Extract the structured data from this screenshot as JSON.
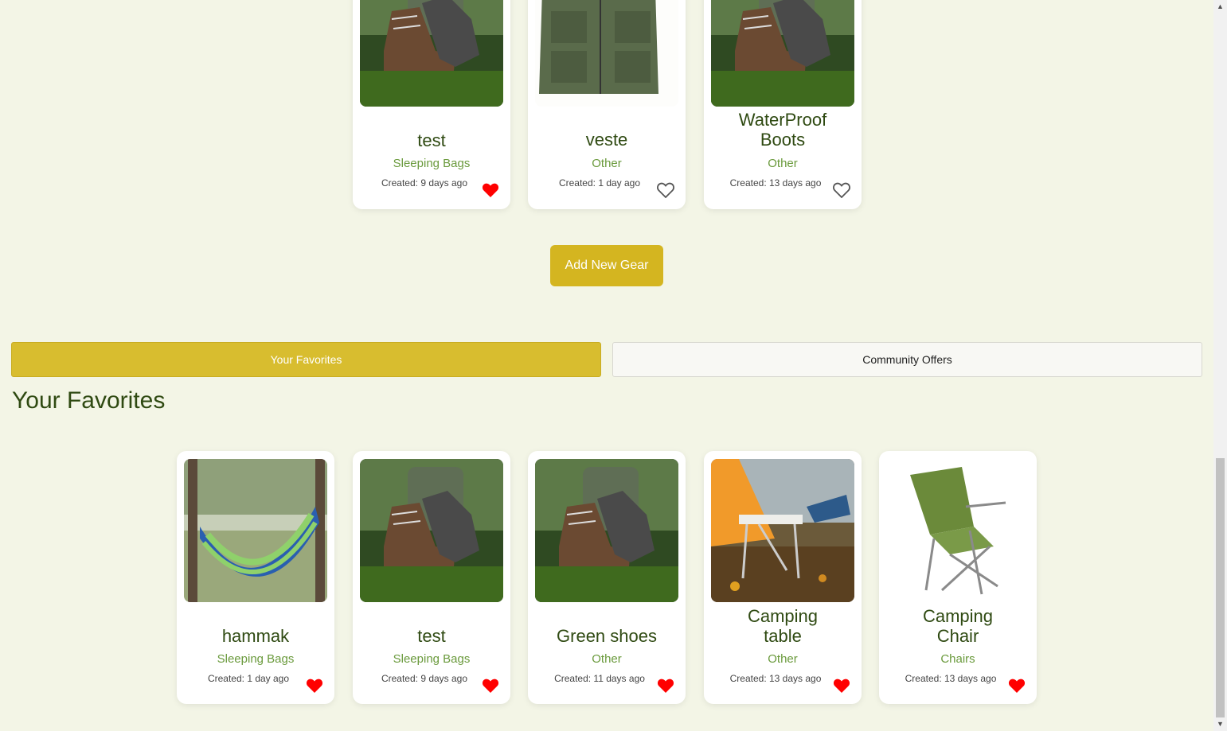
{
  "gear_list": {
    "items": [
      {
        "title": "test",
        "category": "Sleeping Bags",
        "created": "Created: 9 days ago",
        "favorite": true,
        "image": "boots-photo"
      },
      {
        "title": "veste",
        "category": "Other",
        "created": "Created: 1 day ago",
        "favorite": false,
        "image": "vest-photo"
      },
      {
        "title": "WaterProof Boots",
        "category": "Other",
        "created": "Created: 13 days ago",
        "favorite": false,
        "image": "boots-photo"
      }
    ],
    "add_button_label": "Add New Gear"
  },
  "tabs": {
    "favorites_label": "Your Favorites",
    "community_label": "Community Offers",
    "active": "favorites"
  },
  "favorites": {
    "heading": "Your Favorites",
    "items": [
      {
        "title": "hammak",
        "category": "Sleeping Bags",
        "created": "Created: 1 day ago",
        "favorite": true,
        "image": "hammock-photo"
      },
      {
        "title": "test",
        "category": "Sleeping Bags",
        "created": "Created: 9 days ago",
        "favorite": true,
        "image": "boots-photo"
      },
      {
        "title": "Green shoes",
        "category": "Other",
        "created": "Created: 11 days ago",
        "favorite": true,
        "image": "boots-photo"
      },
      {
        "title": "Camping table",
        "category": "Other",
        "created": "Created: 13 days ago",
        "favorite": true,
        "image": "camping-table-photo"
      },
      {
        "title": "Camping Chair",
        "category": "Chairs",
        "created": "Created: 13 days ago",
        "favorite": true,
        "image": "camping-chair-photo"
      }
    ]
  },
  "colors": {
    "background": "#f3f5e6",
    "accent": "#d4b520",
    "title_text": "#2f4a12",
    "category_text": "#6a9a3c",
    "heart_filled": "#ff0000"
  }
}
